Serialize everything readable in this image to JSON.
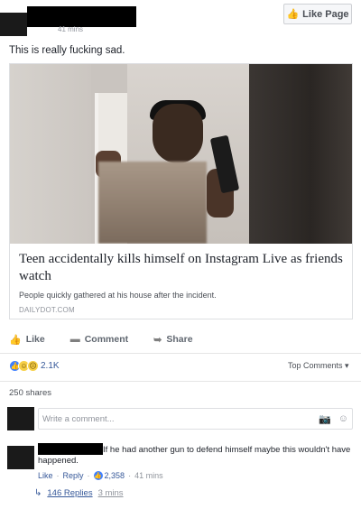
{
  "header": {
    "time_text": "41 mins",
    "like_page_label": "Like Page"
  },
  "post": {
    "text": "This is really fucking sad."
  },
  "link": {
    "title": "Teen accidentally kills himself on Instagram Live as friends watch",
    "description": "People quickly gathered at his house after the incident.",
    "domain": "DAILYDOT.COM"
  },
  "actions": {
    "like": "Like",
    "comment": "Comment",
    "share": "Share"
  },
  "reactions": {
    "count": "2.1K",
    "top_comments": "Top Comments"
  },
  "shares": "250 shares",
  "comment_box": {
    "placeholder": "Write a comment..."
  },
  "comment": {
    "text": "If he had another gun to defend himself maybe this wouldn't have happened.",
    "like": "Like",
    "reply": "Reply",
    "reaction_count": "2,358",
    "time": "41 mins"
  },
  "replies": {
    "label": "146 Replies",
    "time": "3 mins"
  },
  "colors": {
    "link_blue": "#365899",
    "meta_gray": "#90949c",
    "like_blue": "#4080ff"
  }
}
